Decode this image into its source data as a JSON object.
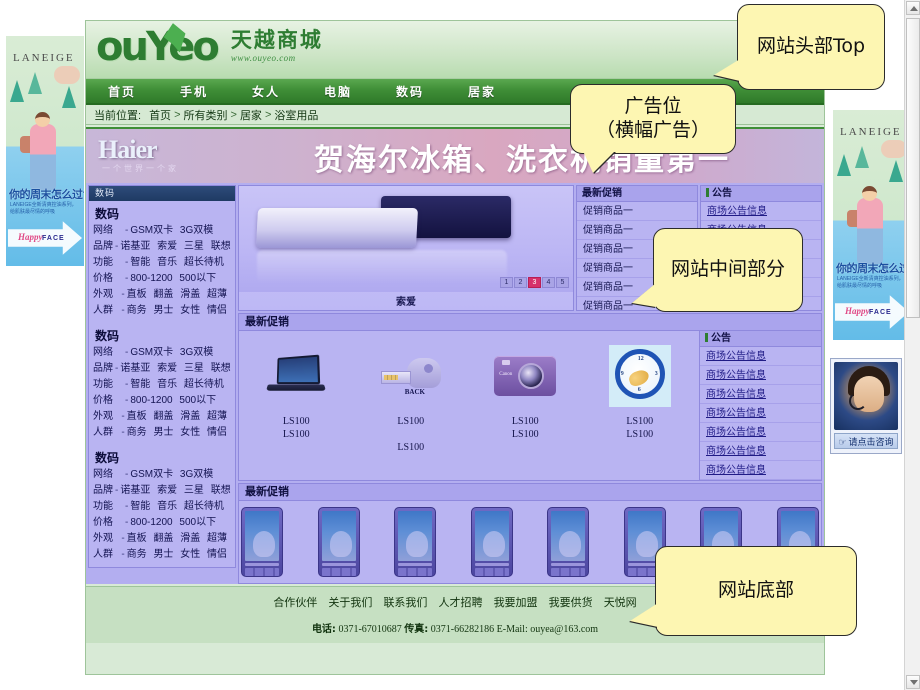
{
  "site": {
    "logo_text": "ouYeo",
    "logo_cn": "天越商城",
    "logo_url": "www.ouyeo.com",
    "nav": [
      {
        "label": "首页"
      },
      {
        "label": "手机"
      },
      {
        "label": "女人"
      },
      {
        "label": "电脑"
      },
      {
        "label": "数码"
      },
      {
        "label": "居家"
      }
    ],
    "breadcrumb": {
      "label": "当前位置:",
      "items": [
        "首页",
        "所有类别",
        "居家",
        "浴室用品"
      ],
      "separator": ">"
    },
    "banner": {
      "brand": "Haier",
      "slogan": "一个世界一个家",
      "headline": "贺海尔冰箱、洗衣机销量第一"
    }
  },
  "sidebar": {
    "panel_header": "数码",
    "blocks": [
      {
        "title": "数码",
        "rows": [
          {
            "key": "网络",
            "values": [
              "GSM双卡",
              "3G双模"
            ]
          },
          {
            "key": "品牌",
            "values": [
              "诺基亚",
              "索爱",
              "三星",
              "联想"
            ]
          },
          {
            "key": "功能",
            "values": [
              "智能",
              "音乐",
              "超长待机"
            ]
          },
          {
            "key": "价格",
            "values": [
              "800-1200",
              "500以下"
            ]
          },
          {
            "key": "外观",
            "values": [
              "直板",
              "翻盖",
              "滑盖",
              "超薄"
            ]
          },
          {
            "key": "人群",
            "values": [
              "商务",
              "男士",
              "女性",
              "情侣"
            ]
          }
        ]
      },
      {
        "title": "数码",
        "rows": [
          {
            "key": "网络",
            "values": [
              "GSM双卡",
              "3G双模"
            ]
          },
          {
            "key": "品牌",
            "values": [
              "诺基亚",
              "索爱",
              "三星",
              "联想"
            ]
          },
          {
            "key": "功能",
            "values": [
              "智能",
              "音乐",
              "超长待机"
            ]
          },
          {
            "key": "价格",
            "values": [
              "800-1200",
              "500以下"
            ]
          },
          {
            "key": "外观",
            "values": [
              "直板",
              "翻盖",
              "滑盖",
              "超薄"
            ]
          },
          {
            "key": "人群",
            "values": [
              "商务",
              "男士",
              "女性",
              "情侣"
            ]
          }
        ]
      },
      {
        "title": "数码",
        "rows": [
          {
            "key": "网络",
            "values": [
              "GSM双卡",
              "3G双模"
            ]
          },
          {
            "key": "品牌",
            "values": [
              "诺基亚",
              "索爱",
              "三星",
              "联想"
            ]
          },
          {
            "key": "功能",
            "values": [
              "智能",
              "音乐",
              "超长待机"
            ]
          },
          {
            "key": "价格",
            "values": [
              "800-1200",
              "500以下"
            ]
          },
          {
            "key": "外观",
            "values": [
              "直板",
              "翻盖",
              "滑盖",
              "超薄"
            ]
          },
          {
            "key": "人群",
            "values": [
              "商务",
              "男士",
              "女性",
              "情侣"
            ]
          }
        ]
      }
    ]
  },
  "showcase": {
    "caption": "索爱",
    "pager": [
      "1",
      "2",
      "3",
      "4",
      "5"
    ],
    "active_page": "3"
  },
  "promo_panel": {
    "title": "最新促销",
    "items": [
      "促销商品一",
      "促销商品一",
      "促销商品一",
      "促销商品一",
      "促销商品一",
      "促销商品一"
    ]
  },
  "notice_panel_top": {
    "title": "公告",
    "items": [
      "商场公告信息",
      "商场公告信息",
      "商场公告信息",
      "商场公告信息",
      "商场公告信息"
    ]
  },
  "notice_panel_side": {
    "title": "公告",
    "items": [
      "商场公告信息",
      "商场公告信息",
      "商场公告信息",
      "商场公告信息",
      "商场公告信息",
      "商场公告信息",
      "商场公告信息"
    ]
  },
  "promo_section": {
    "title": "最新促销",
    "products": [
      {
        "art": "laptop",
        "lines": [
          "LS100",
          "LS100"
        ]
      },
      {
        "art": "usb",
        "lines": [
          "LS100",
          "LS100"
        ]
      },
      {
        "art": "camera",
        "lines": [
          "LS100",
          "LS100"
        ]
      },
      {
        "art": "clock",
        "lines": [
          "LS100",
          "LS100"
        ]
      }
    ]
  },
  "bottom_section": {
    "title": "最新促销",
    "phones": [
      1,
      2,
      3,
      4,
      5,
      6,
      7,
      8
    ]
  },
  "footer": {
    "links": [
      "合作伙伴",
      "关于我们",
      "联系我们",
      "人才招聘",
      "我要加盟",
      "我要供货",
      "天悦网"
    ],
    "phone_label": "电话:",
    "phone": "0371-67010687",
    "fax_label": "传真:",
    "fax": "0371-66282186",
    "email_label": "E-Mail:",
    "email": "ouyea@163.com"
  },
  "customer_service": {
    "button_label": "请点击咨询",
    "hand_icon": "☞"
  },
  "side_ads": {
    "left": {
      "brand": "LANEIGE",
      "headline": "你的周末怎么过?",
      "sub": "LANEIGE全新清爽控油系列，给肌肤最尽情的呼吸",
      "arrow_text": "Happy",
      "arrow_text2": "FACE"
    },
    "right": {
      "brand": "LANEIGE",
      "headline": "你的周末怎么过?",
      "sub": "LANEIGE全新清爽控油系列，给肌肤最尽情的呼吸",
      "arrow_text": "Happy",
      "arrow_text2": "FACE"
    }
  },
  "callouts": {
    "top": "网站头部Top",
    "ad_line1": "广告位",
    "ad_line2": "（横幅广告）",
    "middle": "网站中间部分",
    "bottom": "网站底部"
  },
  "colors": {
    "brand_green": "#2e7d32",
    "nav_green": "#3f8e37",
    "body_purple": "#b3aef0",
    "panel_purple": "#b9b4f2",
    "callout_yellow": "#fdf6b2",
    "active_page_red": "#d6316b"
  }
}
